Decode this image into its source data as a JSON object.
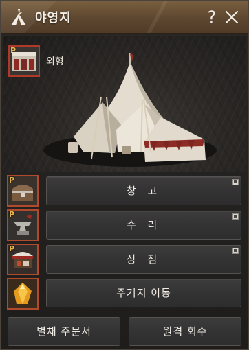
{
  "window": {
    "title": "야영지",
    "help_label": "?",
    "title_icon": "camp-flag-icon",
    "close_icon": "close-icon"
  },
  "appearance": {
    "badge": "P",
    "label": "외형",
    "icon": "camp-appearance-icon"
  },
  "services": [
    {
      "badge": "P",
      "label": "창 고",
      "icon": "treasure-chest-icon"
    },
    {
      "badge": "P",
      "label": "수 리",
      "icon": "anvil-icon"
    },
    {
      "badge": "P",
      "label": "상 점",
      "icon": "shop-stall-icon"
    },
    {
      "badge": "",
      "label": "주거지 이동",
      "icon": "amber-crystal-icon"
    }
  ],
  "bottom_buttons": {
    "left_label": "별채 주문서",
    "right_label": "원격 회수"
  },
  "colors": {
    "title_bar": "#6b5136",
    "slot_border": "#b04a2c",
    "badge": "#e8b64a",
    "button_bg": "#363536"
  }
}
